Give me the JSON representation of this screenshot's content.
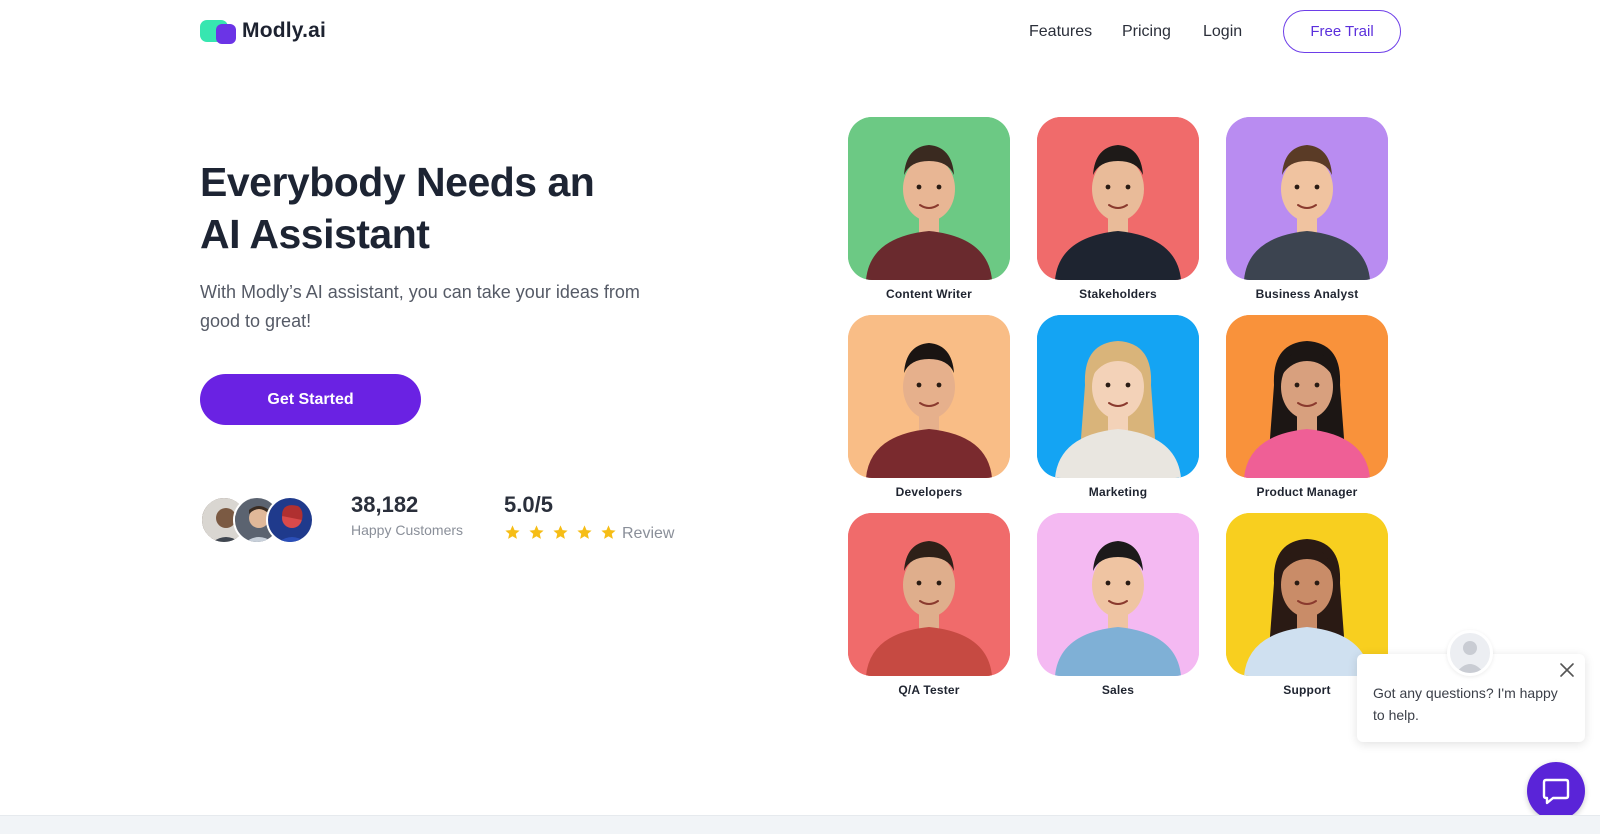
{
  "header": {
    "logo_text": "Modly.ai",
    "nav": [
      "Features",
      "Pricing",
      "Login"
    ],
    "cta_label": "Free Trail"
  },
  "hero": {
    "title_line1": "Everybody Needs an",
    "title_line2": "AI Assistant",
    "subtitle": "With Modly’s AI assistant, you can take your ideas from good to great!",
    "cta_label": "Get Started"
  },
  "stats": {
    "customers_count": "38,182",
    "customers_label": "Happy Customers",
    "rating_value": "5.0/5",
    "rating_stars": 5,
    "rating_label": "Review"
  },
  "personas": [
    {
      "label": "Content Writer",
      "bg": "#6cc984"
    },
    {
      "label": "Stakeholders",
      "bg": "#f06b6b"
    },
    {
      "label": "Business Analyst",
      "bg": "#b98cf1"
    },
    {
      "label": "Developers",
      "bg": "#f9bd86"
    },
    {
      "label": "Marketing",
      "bg": "#14a4f3"
    },
    {
      "label": "Product Manager",
      "bg": "#f9923b"
    },
    {
      "label": "Q/A Tester",
      "bg": "#f06b6b"
    },
    {
      "label": "Sales",
      "bg": "#f4b9f2"
    },
    {
      "label": "Support",
      "bg": "#f8cf1f"
    }
  ],
  "chat": {
    "message": "Got any questions? I'm happy to help."
  },
  "colors": {
    "brand_purple": "#6a22e3",
    "brand_green": "#37e6b0",
    "star": "#f6bd16"
  }
}
